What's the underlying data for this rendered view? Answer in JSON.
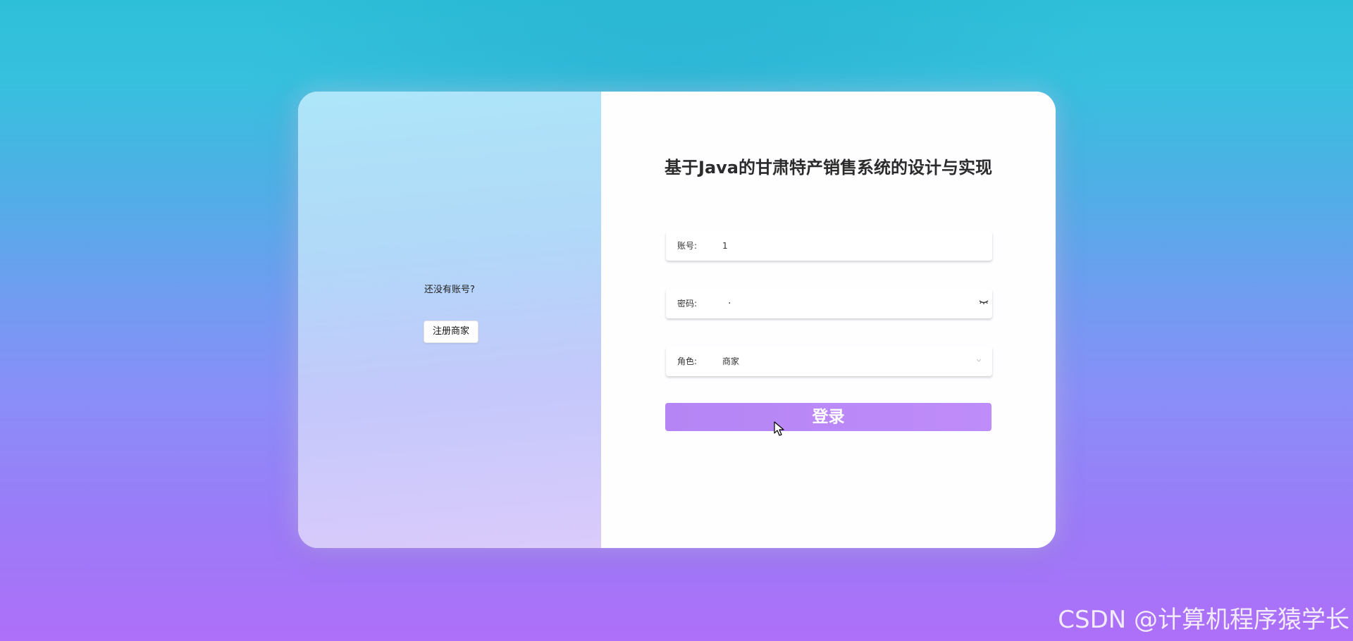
{
  "left_panel": {
    "prompt": "还没有账号?",
    "register_button": "注册商家"
  },
  "login_form": {
    "title": "基于Java的甘肃特产销售系统的设计与实现",
    "account": {
      "label": "账号:",
      "value": "1"
    },
    "password": {
      "label": "密码:",
      "value": "·",
      "toggle_icon": "eye-closed-icon"
    },
    "role": {
      "label": "角色:",
      "value": "商家",
      "dropdown_icon": "chevron-down-icon"
    },
    "login_button": "登录"
  },
  "watermark": "CSDN @计算机程序猿学长",
  "colors": {
    "background_top": "#2ebfd8",
    "background_bottom": "#ae6ff8",
    "login_button": "#bf8cf9",
    "left_panel_top": "#ade6f9",
    "left_panel_bottom": "#dacbfb"
  }
}
